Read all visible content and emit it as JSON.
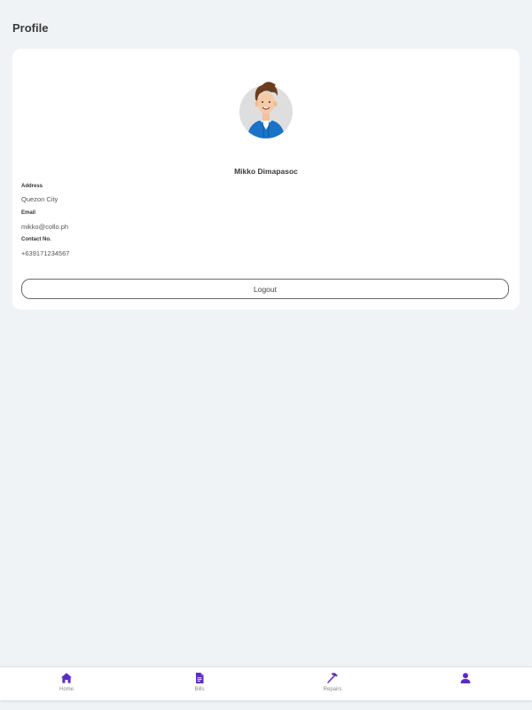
{
  "header": {
    "title": "Profile"
  },
  "profile": {
    "name": "Mikko Dimapasoc",
    "fields": [
      {
        "label": "Address",
        "value": "Quezon City"
      },
      {
        "label": "Email",
        "value": "mikko@collo.ph"
      },
      {
        "label": "Contact No.",
        "value": "+639171234567"
      }
    ],
    "logout_label": "Logout"
  },
  "nav": {
    "items": [
      {
        "label": "Home",
        "icon": "home-icon"
      },
      {
        "label": "Bills",
        "icon": "bills-icon"
      },
      {
        "label": "Repairs",
        "icon": "hammer-icon"
      },
      {
        "label": "",
        "icon": "user-icon",
        "active": true
      }
    ]
  },
  "colors": {
    "accent": "#5b2bc2",
    "background": "#eff3f6",
    "card": "#ffffff",
    "avatar_jacket": "#1a73c8"
  }
}
